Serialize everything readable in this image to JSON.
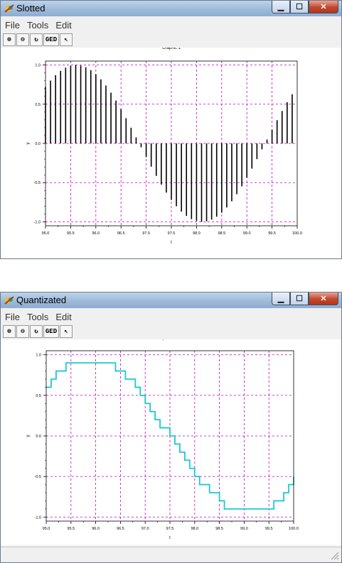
{
  "windows": [
    {
      "title": "Slotted",
      "menu": [
        "File",
        "Tools",
        "Edit"
      ],
      "toolbar": [
        "zoom-in-icon",
        "zoom-out-icon",
        "rotate-icon",
        "GED",
        "pointer-icon"
      ],
      "ged_label": "GED",
      "chart_data": {
        "type": "bar",
        "title": "Graphic 1",
        "xlabel": "t",
        "ylabel": "y",
        "xlim": [
          95.0,
          100.0
        ],
        "ylim": [
          -1.05,
          1.05
        ],
        "xticks": [
          "95.0",
          "95.5",
          "96.0",
          "96.5",
          "97.0",
          "97.5",
          "98.0",
          "98.5",
          "99.0",
          "99.5",
          "100.0"
        ],
        "yticks": [
          "1.0",
          "0.5",
          "0.0",
          "-0.5",
          "-1.0"
        ],
        "grid": true,
        "color": "#000000",
        "period": 5.0,
        "phase_start": 95.0,
        "start_value": 0.72,
        "sample_step": 0.1
      }
    },
    {
      "title": "Quantizated",
      "menu": [
        "File",
        "Tools",
        "Edit"
      ],
      "toolbar": [
        "zoom-in-icon",
        "zoom-out-icon",
        "rotate-icon",
        "GED",
        "pointer-icon"
      ],
      "ged_label": "GED",
      "chart_data": {
        "type": "line",
        "title": "Quantizer",
        "xlabel": "t",
        "ylabel": "y",
        "xlim": [
          95.0,
          100.0
        ],
        "ylim": [
          -1.05,
          1.05
        ],
        "xticks": [
          "95.0",
          "95.5",
          "96.0",
          "96.5",
          "97.0",
          "97.5",
          "98.0",
          "98.5",
          "99.0",
          "99.5",
          "100.0"
        ],
        "yticks": [
          "1.0",
          "0.5",
          "0.0",
          "-0.5",
          "-1.0"
        ],
        "grid": true,
        "color": "#1ec8d2",
        "step_x": [
          95.0,
          95.1,
          95.2,
          95.4,
          96.4,
          96.6,
          96.8,
          96.9,
          97.0,
          97.1,
          97.2,
          97.3,
          97.5,
          97.6,
          97.7,
          97.8,
          97.9,
          98.0,
          98.1,
          98.3,
          98.5,
          98.6,
          99.6,
          99.8,
          99.9,
          100.0
        ],
        "step_y": [
          0.6,
          0.7,
          0.8,
          0.9,
          0.8,
          0.7,
          0.6,
          0.5,
          0.4,
          0.3,
          0.2,
          0.1,
          0.0,
          -0.1,
          -0.2,
          -0.3,
          -0.4,
          -0.5,
          -0.6,
          -0.7,
          -0.8,
          -0.9,
          -0.8,
          -0.7,
          -0.6,
          -0.5
        ]
      }
    }
  ]
}
